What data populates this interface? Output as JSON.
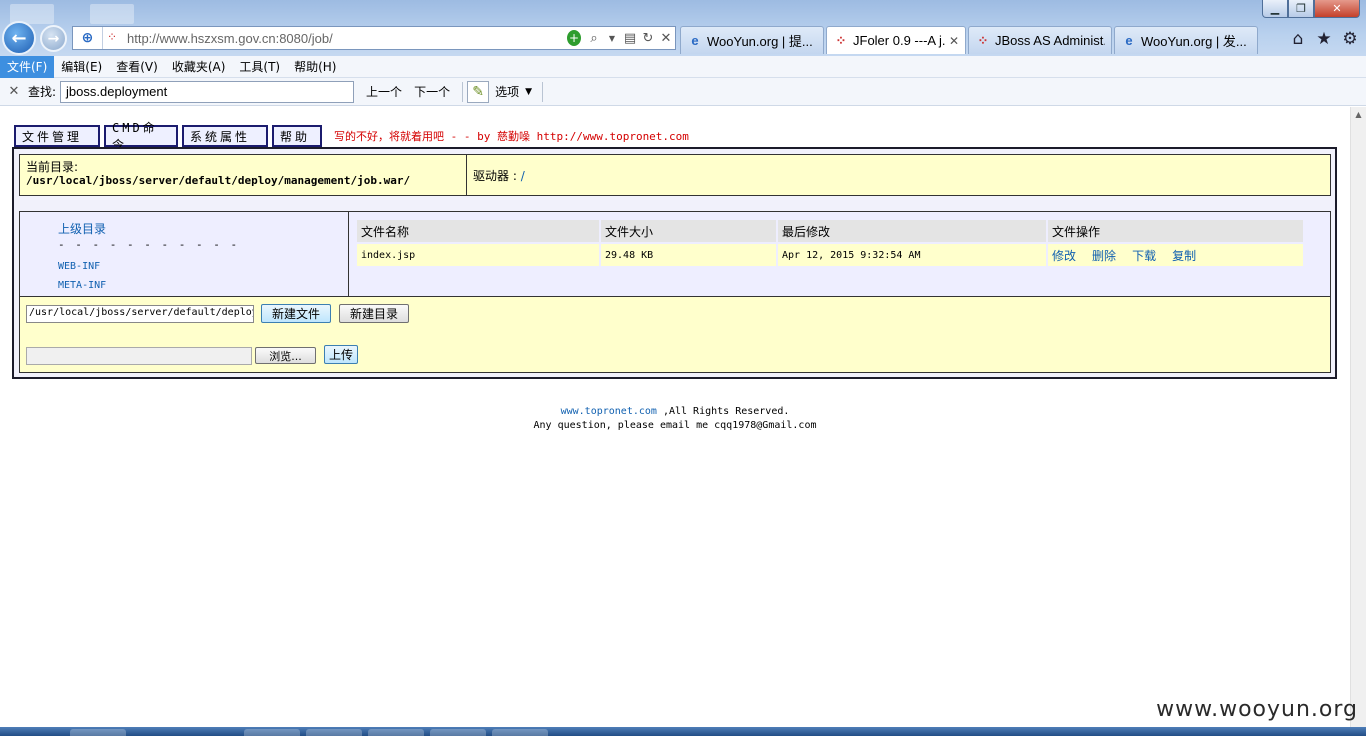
{
  "browser": {
    "address_url": "http://www.hszxsm.gov.cn:8080/job/",
    "tabs": [
      {
        "label": "WooYun.org | 提...",
        "icon": "ie-icon"
      },
      {
        "label": "JFoler 0.9 ---A j...",
        "icon": "page-icon",
        "active": true
      },
      {
        "label": "JBoss AS Administ...",
        "icon": "jboss-icon"
      },
      {
        "label": "WooYun.org | 发...",
        "icon": "ie-icon"
      }
    ]
  },
  "menubar": {
    "items": [
      "文件(F)",
      "编辑(E)",
      "查看(V)",
      "收藏夹(A)",
      "工具(T)",
      "帮助(H)"
    ]
  },
  "findbar": {
    "label": "查找:",
    "value": "jboss.deployment",
    "prev": "上一个",
    "next": "下一个",
    "options": "选项"
  },
  "page": {
    "nav": [
      "文件管理",
      "CMD命令",
      "系统属性",
      "帮助"
    ],
    "motto": "写的不好，将就着用吧 - - by 慈勤噪 http://www.topronet.com",
    "current_dir_label": "当前目录:",
    "current_dir_path": "/usr/local/jboss/server/default/deploy/management/job.war/",
    "drive_label": "驱动器 :",
    "drive_path": "/",
    "parent_dir": "上级目录",
    "tree_separator": "- - - - - - - - - - -",
    "folders": [
      "WEB-INF",
      "META-INF"
    ],
    "table_headers": [
      "文件名称",
      "文件大小",
      "最后修改",
      "文件操作"
    ],
    "files": [
      {
        "name": "index.jsp",
        "size": "29.48 KB",
        "modified": "Apr 12, 2015 9:32:54 AM",
        "ops": [
          "修改",
          "删除",
          "下载",
          "复制"
        ]
      }
    ],
    "path_input_value": "/usr/local/jboss/server/default/deploy/management/job.war/",
    "new_file_button": "新建文件",
    "new_dir_button": "新建目录",
    "browse_button": "浏览...",
    "upload_button": "上传",
    "footer_link": "www.topronet.com",
    "footer_rights": ",All Rights Reserved.",
    "footer_contact": "Any question, please email me cqq1978@Gmail.com"
  },
  "watermark": "www.wooyun.org"
}
